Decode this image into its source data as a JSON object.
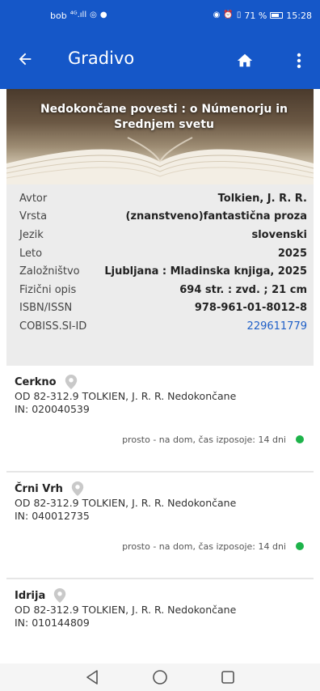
{
  "status_bar": {
    "carrier": "bob",
    "signal": "⁴ᴳ.ıll",
    "alarm": "⏰",
    "vibrate": "▯",
    "battery_percent": "71 %",
    "time": "15:28"
  },
  "app_bar": {
    "title": "Gradivo",
    "back_icon": "arrow-left",
    "home_icon": "home",
    "menu_icon": "more-vertical"
  },
  "hero": {
    "title": "Nedokončane povesti : o Númenorju in Srednjem svetu"
  },
  "details": [
    {
      "label": "Avtor",
      "value": "Tolkien, J. R. R."
    },
    {
      "label": "Vrsta",
      "value": "(znanstveno)fantastična proza"
    },
    {
      "label": "Jezik",
      "value": "slovenski"
    },
    {
      "label": "Leto",
      "value": "2025"
    },
    {
      "label": "Založništvo",
      "value": "Ljubljana : Mladinska knjiga, 2025"
    },
    {
      "label": "Fizični opis",
      "value": "694 str. : zvd. ; 21 cm"
    },
    {
      "label": "ISBN/ISSN",
      "value": "978-961-01-8012-8"
    },
    {
      "label": "COBISS.SI-ID",
      "value": "229611779"
    }
  ],
  "holdings": [
    {
      "location": "Cerkno",
      "call_number": "OD 82-312.9 TOLKIEN, J. R. R. Nedokončane",
      "inventory": "IN: 020040539",
      "status": "prosto - na dom, čas izposoje: 14 dni"
    },
    {
      "location": "Črni Vrh",
      "call_number": "OD 82-312.9 TOLKIEN, J. R. R. Nedokončane",
      "inventory": "IN: 040012735",
      "status": "prosto - na dom, čas izposoje: 14 dni"
    },
    {
      "location": "Idrija",
      "call_number": "OD 82-312.9 TOLKIEN, J. R. R. Nedokončane",
      "inventory": "IN: 010144809",
      "status": ""
    }
  ],
  "colors": {
    "primary": "#1557c8",
    "link": "#1e5fc7",
    "available": "#1db34a"
  }
}
